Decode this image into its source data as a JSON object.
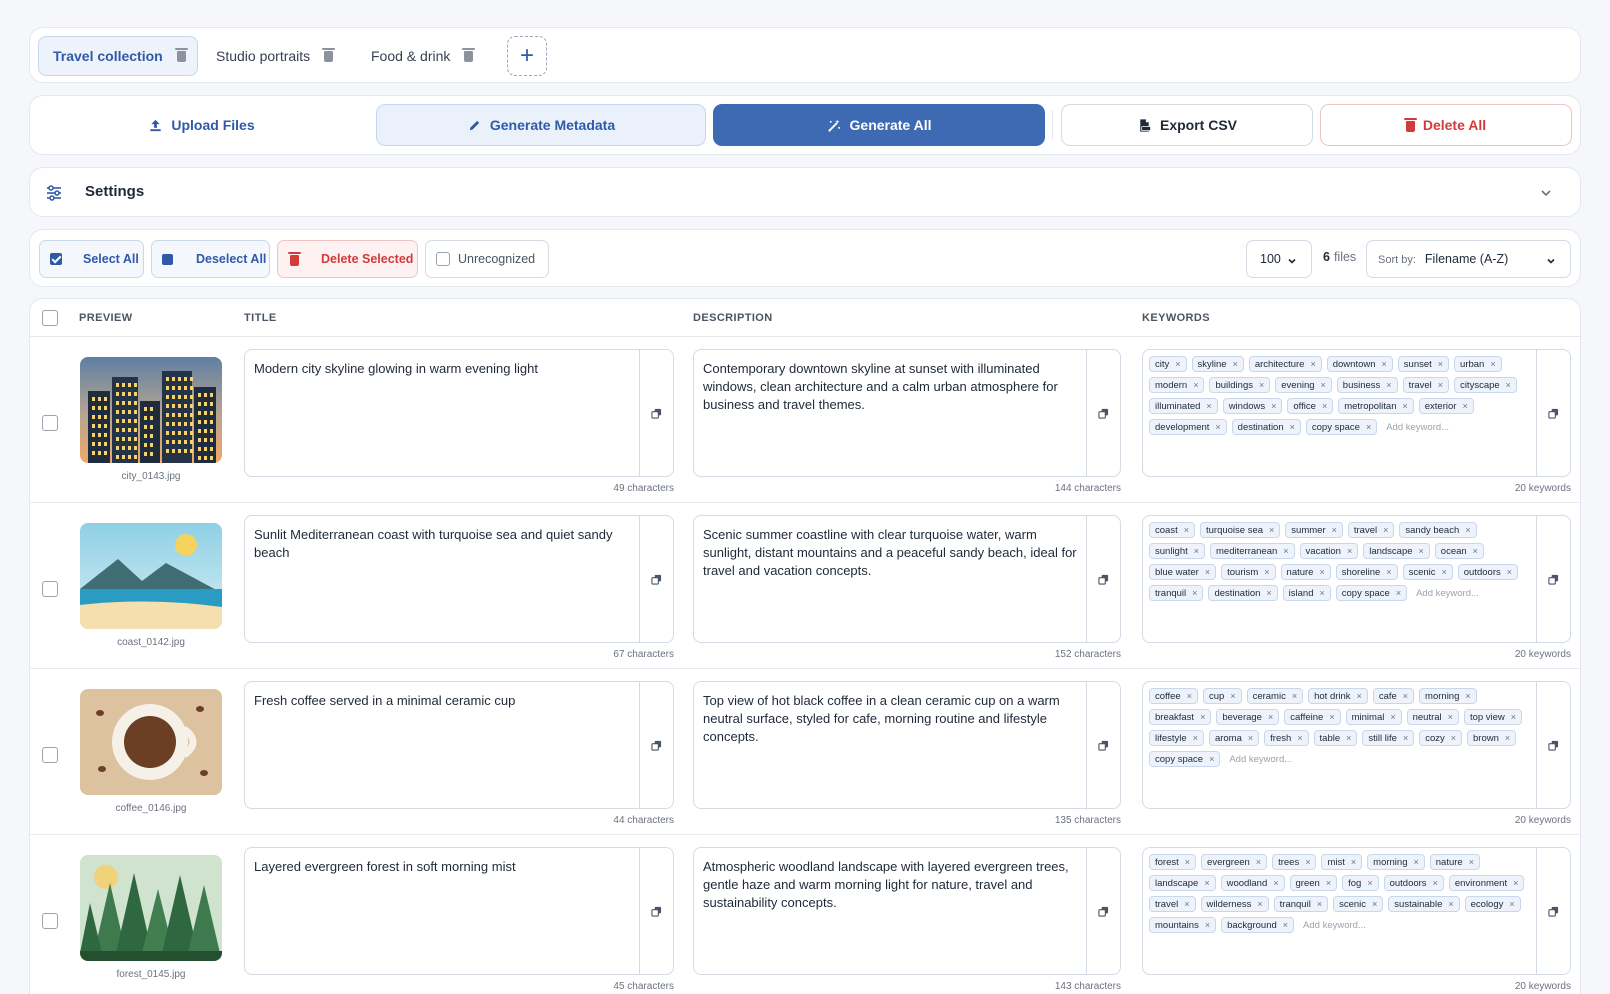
{
  "tabs": [
    {
      "label": "Travel collection",
      "active": true
    },
    {
      "label": "Studio portraits",
      "active": false
    },
    {
      "label": "Food & drink",
      "active": false
    }
  ],
  "tabs_add": "+",
  "actions": {
    "upload": "Upload Files",
    "generate_metadata": "Generate Metadata",
    "generate_all": "Generate All",
    "export_csv": "Export CSV",
    "delete_all": "Delete All"
  },
  "settings": {
    "title": "Settings"
  },
  "selection": {
    "select_all": "Select All",
    "deselect_all": "Deselect All",
    "delete_selected": "Delete Selected",
    "unrecognized": "Unrecognized",
    "page_size": "100",
    "file_count": "6",
    "files_label": "files",
    "sort_label": "Sort by:",
    "sort_value": "Filename (A-Z)"
  },
  "table": {
    "headers": {
      "preview": "PREVIEW",
      "title": "TITLE",
      "description": "DESCRIPTION",
      "keywords": "KEYWORDS"
    },
    "add_keyword_placeholder": "Add keyword...",
    "rows": [
      {
        "filename": "city_0143.jpg",
        "image": "city-skyline",
        "title": "Modern city skyline glowing in warm evening light",
        "title_count": "49 characters",
        "description": "Contemporary downtown skyline at sunset with illuminated windows, clean architecture and a calm urban atmosphere for business and travel themes.",
        "description_count": "144 characters",
        "keywords": [
          "city",
          "skyline",
          "architecture",
          "downtown",
          "sunset",
          "urban",
          "modern",
          "buildings",
          "evening",
          "business",
          "travel",
          "cityscape",
          "illuminated",
          "windows",
          "office",
          "metropolitan",
          "exterior",
          "development",
          "destination",
          "copy space"
        ],
        "keywords_count": "20 keywords"
      },
      {
        "filename": "coast_0142.jpg",
        "image": "coast",
        "title": "Sunlit Mediterranean coast with turquoise sea and quiet sandy beach",
        "title_count": "67 characters",
        "description": "Scenic summer coastline with clear turquoise water, warm sunlight, distant mountains and a peaceful sandy beach, ideal for travel and vacation concepts.",
        "description_count": "152 characters",
        "keywords": [
          "coast",
          "turquoise sea",
          "summer",
          "travel",
          "sandy beach",
          "sunlight",
          "mediterranean",
          "vacation",
          "landscape",
          "ocean",
          "blue water",
          "tourism",
          "nature",
          "shoreline",
          "scenic",
          "outdoors",
          "tranquil",
          "destination",
          "island",
          "copy space"
        ],
        "keywords_count": "20 keywords"
      },
      {
        "filename": "coffee_0146.jpg",
        "image": "coffee",
        "title": "Fresh coffee served in a minimal ceramic cup",
        "title_count": "44 characters",
        "description": "Top view of hot black coffee in a clean ceramic cup on a warm neutral surface, styled for cafe, morning routine and lifestyle concepts.",
        "description_count": "135 characters",
        "keywords": [
          "coffee",
          "cup",
          "ceramic",
          "hot drink",
          "cafe",
          "morning",
          "breakfast",
          "beverage",
          "caffeine",
          "minimal",
          "neutral",
          "top view",
          "lifestyle",
          "aroma",
          "fresh",
          "table",
          "still life",
          "cozy",
          "brown",
          "copy space"
        ],
        "keywords_count": "20 keywords"
      },
      {
        "filename": "forest_0145.jpg",
        "image": "forest",
        "title": "Layered evergreen forest in soft morning mist",
        "title_count": "45 characters",
        "description": "Atmospheric woodland landscape with layered evergreen trees, gentle haze and warm morning light for nature, travel and sustainability concepts.",
        "description_count": "143 characters",
        "keywords": [
          "forest",
          "evergreen",
          "trees",
          "mist",
          "morning",
          "nature",
          "landscape",
          "woodland",
          "green",
          "fog",
          "outdoors",
          "environment",
          "travel",
          "wilderness",
          "tranquil",
          "scenic",
          "sustainable",
          "ecology",
          "mountains",
          "background"
        ],
        "keywords_count": "20 keywords"
      }
    ]
  },
  "colors": {
    "primary": "#3e6ab3",
    "accent_light": "#eef3fb",
    "danger": "#d23b3b",
    "page_bg": "#f5f7fa"
  }
}
